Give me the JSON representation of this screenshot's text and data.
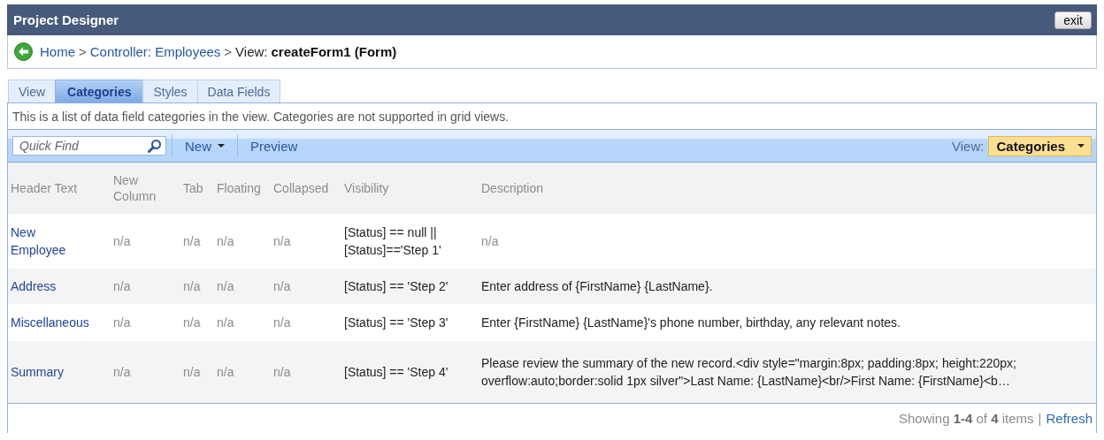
{
  "window": {
    "title": "Project Designer",
    "exit_button": "exit"
  },
  "breadcrumb": {
    "separator": ">",
    "items": [
      {
        "label": "Home",
        "kind": "link"
      },
      {
        "label": "Controller: Employees",
        "kind": "link"
      },
      {
        "label": "View:",
        "kind": "plain"
      },
      {
        "label": "createForm1 (Form)",
        "kind": "bold"
      }
    ]
  },
  "tabs": [
    {
      "label": "View",
      "selected": false
    },
    {
      "label": "Categories",
      "selected": true
    },
    {
      "label": "Styles",
      "selected": false
    },
    {
      "label": "Data Fields",
      "selected": false
    }
  ],
  "info": "This is a list of data field categories in the view. Categories are not supported in grid views.",
  "toolbar": {
    "quick_find": {
      "placeholder": "Quick Find"
    },
    "new_button": "New",
    "preview_button": "Preview",
    "view_label": "View:",
    "view_value": "Categories"
  },
  "table": {
    "columns": [
      "Header Text",
      "New Column",
      "Tab",
      "Floating",
      "Collapsed",
      "Visibility",
      "Description"
    ],
    "rows": [
      {
        "cells": [
          "New Employee",
          "n/a",
          "n/a",
          "n/a",
          "n/a",
          "[Status] == null || [Status]=='Step 1'",
          "n/a"
        ]
      },
      {
        "cells": [
          "Address",
          "n/a",
          "n/a",
          "n/a",
          "n/a",
          "[Status] == 'Step 2'",
          "Enter address of {FirstName} {LastName}."
        ]
      },
      {
        "cells": [
          "Miscellaneous",
          "n/a",
          "n/a",
          "n/a",
          "n/a",
          "[Status] == 'Step 3'",
          "Enter {FirstName} {LastName}'s phone number, birthday, any relevant notes."
        ]
      },
      {
        "cells": [
          "Summary",
          "n/a",
          "n/a",
          "n/a",
          "n/a",
          "[Status] == 'Step 4'",
          "Please review the summary of the new record.<div style=\"margin:8px; padding:8px; height:220px; overflow:auto;border:solid 1px silver\">Last Name: {LastName}<br/>First Name: {FirstName}<b…"
        ]
      }
    ]
  },
  "footer": {
    "summary": "Showing **1-4** of **4** items",
    "separator": "|",
    "refresh_link": "Refresh"
  }
}
